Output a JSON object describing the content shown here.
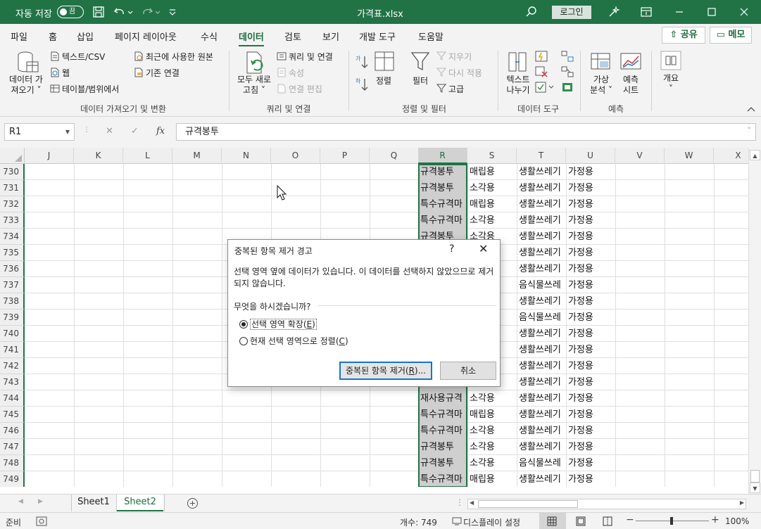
{
  "titlebar": {
    "autosave_label": "자동 저장",
    "autosave_state": "끔",
    "doc_title": "가격표.xlsx",
    "login_label": "로그인"
  },
  "tabs": {
    "items": [
      "파일",
      "홈",
      "삽입",
      "페이지 레이아웃",
      "수식",
      "데이터",
      "검토",
      "보기",
      "개발 도구",
      "도움말"
    ],
    "active": "데이터",
    "share_label": "공유",
    "memo_label": "메모"
  },
  "ribbon": {
    "get_data_line1": "데이터 가",
    "get_data_line2": "져오기",
    "text_csv": "텍스트/CSV",
    "web": "웹",
    "table_range": "테이블/범위에서",
    "recent_sources": "최근에 사용한 원본",
    "existing_conn": "기존 연결",
    "group_get_transform": "데이터 가져오기 및 변환",
    "refresh_all_line1": "모두 새로",
    "refresh_all_line2": "고침",
    "queries_conn": "쿼리 및 연결",
    "properties": "속성",
    "edit_links": "연결 편집",
    "group_queries": "쿼리 및 연결",
    "sort": "정렬",
    "filter": "필터",
    "clear": "지우기",
    "reapply": "다시 적용",
    "advanced": "고급",
    "group_sort_filter": "정렬 및 필터",
    "text_to_col_line1": "텍스트",
    "text_to_col_line2": "나누기",
    "group_data_tools": "데이터 도구",
    "whatif_line1": "가상",
    "whatif_line2": "분석",
    "forecast_line1": "예측",
    "forecast_line2": "시트",
    "group_forecast": "예측",
    "outline": "개요"
  },
  "formula_bar": {
    "name_box": "R1",
    "formula": "규격봉투"
  },
  "grid": {
    "columns": [
      "J",
      "K",
      "L",
      "M",
      "N",
      "O",
      "P",
      "Q",
      "R",
      "S",
      "T",
      "U",
      "V",
      "W",
      "X"
    ],
    "selected_column": "R",
    "rows": [
      {
        "n": "730",
        "R": "규격봉투",
        "S": "매립용",
        "T": "생활쓰레기",
        "U": "가정용"
      },
      {
        "n": "731",
        "R": "규격봉투",
        "S": "소각용",
        "T": "생활쓰레기",
        "U": "가정용"
      },
      {
        "n": "732",
        "R": "특수규격마",
        "S": "매립용",
        "T": "생활쓰레기",
        "U": "가정용"
      },
      {
        "n": "733",
        "R": "특수규격마",
        "S": "소각용",
        "T": "생활쓰레기",
        "U": "가정용"
      },
      {
        "n": "734",
        "R": "규격봉투",
        "S": "소각용",
        "T": "생활쓰레기",
        "U": "가정용"
      },
      {
        "n": "735",
        "R": "",
        "S": "",
        "T": "생활쓰레기",
        "U": "가정용"
      },
      {
        "n": "736",
        "R": "",
        "S": "",
        "T": "생활쓰레기",
        "U": "가정용"
      },
      {
        "n": "737",
        "R": "",
        "S": "",
        "T": "음식물쓰레",
        "U": "가정용"
      },
      {
        "n": "738",
        "R": "",
        "S": "",
        "T": "생활쓰레기",
        "U": "가정용"
      },
      {
        "n": "739",
        "R": "",
        "S": "",
        "T": "음식물쓰레",
        "U": "가정용"
      },
      {
        "n": "740",
        "R": "",
        "S": "",
        "T": "생활쓰레기",
        "U": "가정용"
      },
      {
        "n": "741",
        "R": "",
        "S": "",
        "T": "생활쓰레기",
        "U": "가정용"
      },
      {
        "n": "742",
        "R": "",
        "S": "",
        "T": "생활쓰레기",
        "U": "가정용"
      },
      {
        "n": "743",
        "R": "",
        "S": "",
        "T": "생활쓰레기",
        "U": "가정용"
      },
      {
        "n": "744",
        "R": "재사용규격",
        "S": "소각용",
        "T": "생활쓰레기",
        "U": "가정용"
      },
      {
        "n": "745",
        "R": "특수규격마",
        "S": "매립용",
        "T": "생활쓰레기",
        "U": "가정용"
      },
      {
        "n": "746",
        "R": "특수규격마",
        "S": "소각용",
        "T": "생활쓰레기",
        "U": "가정용"
      },
      {
        "n": "747",
        "R": "규격봉투",
        "S": "소각용",
        "T": "생활쓰레기",
        "U": "가정용"
      },
      {
        "n": "748",
        "R": "규격봉투",
        "S": "소각용",
        "T": "음식물쓰레",
        "U": "가정용"
      },
      {
        "n": "749",
        "R": "특수규격마",
        "S": "매립용",
        "T": "생활쓰레기",
        "U": "가정용"
      }
    ]
  },
  "sheets": {
    "items": [
      "Sheet1",
      "Sheet2"
    ],
    "active": "Sheet2"
  },
  "status": {
    "ready": "준비",
    "count": "개수: 749",
    "display_settings": "디스플레이 설정",
    "zoom": "100%"
  },
  "dialog": {
    "title": "중복된 항목 제거 경고",
    "help": "?",
    "close": "✕",
    "message": "선택 영역 옆에 데이터가 있습니다. 이 데이터를 선택하지 않았으므로 제거되지 않습니다.",
    "question": "무엇을 하시겠습니까?",
    "option1": "선택 영역 확장",
    "option1_key": "E",
    "option2": "현재 선택 영역으로 정렬",
    "option2_key": "C",
    "primary_button": "중복된 항목 제거",
    "primary_key": "R",
    "cancel_button": "취소"
  }
}
